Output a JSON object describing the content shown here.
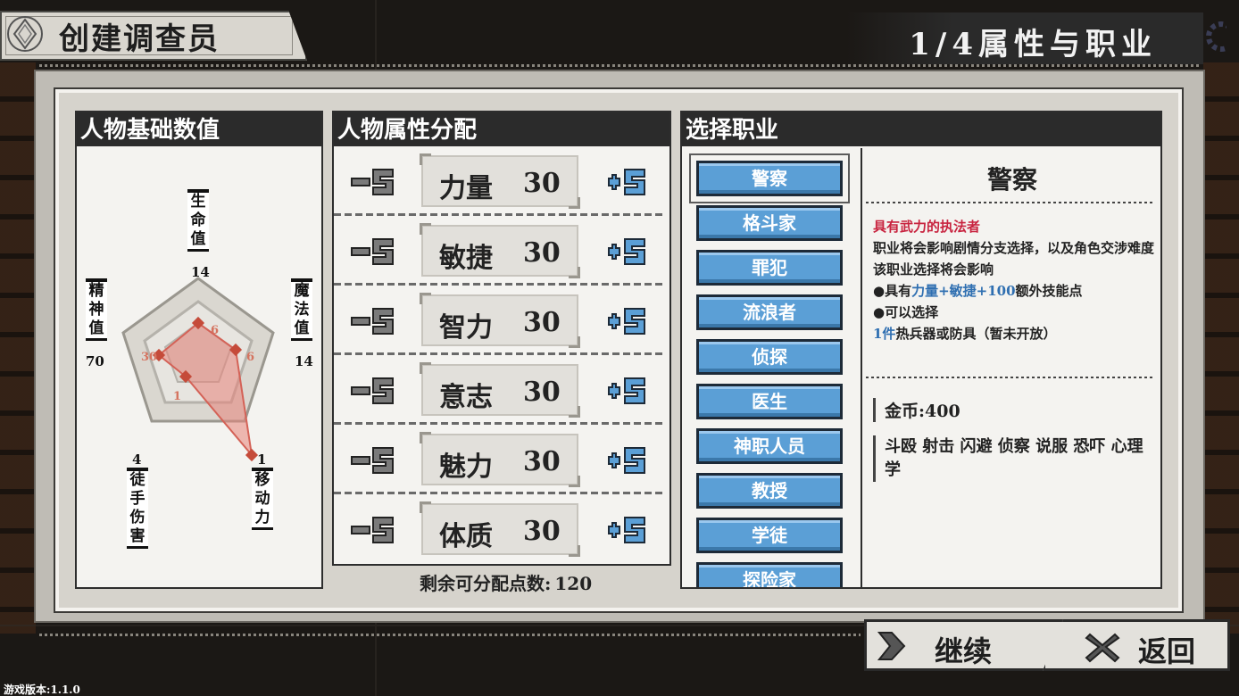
{
  "header": {
    "title": "创建调查员",
    "step": "1/4属性与职业"
  },
  "stats_panel": {
    "title": "人物基础数值",
    "vertices": [
      {
        "label": "生\n命\n值",
        "value": "14"
      },
      {
        "label": "魔\n法\n值",
        "value": "14"
      },
      {
        "label": "移\n动\n力",
        "value": "1"
      },
      {
        "label": "徒\n手\n伤\n害",
        "value": "4"
      },
      {
        "label": "精\n神\n值",
        "value": "70"
      }
    ],
    "inner_labels": {
      "top": "6",
      "right": "6",
      "left": "30",
      "lower_left": "1"
    }
  },
  "attributes_panel": {
    "title": "人物属性分配",
    "attributes": [
      {
        "name": "力量",
        "value": "30"
      },
      {
        "name": "敏捷",
        "value": "30"
      },
      {
        "name": "智力",
        "value": "30"
      },
      {
        "name": "意志",
        "value": "30"
      },
      {
        "name": "魅力",
        "value": "30"
      },
      {
        "name": "体质",
        "value": "30"
      }
    ],
    "remaining_label": "剩余可分配点数:",
    "remaining_value": "120"
  },
  "jobs_panel": {
    "title": "选择职业",
    "jobs": [
      "警察",
      "格斗家",
      "罪犯",
      "流浪者",
      "侦探",
      "医生",
      "神职人员",
      "教授",
      "学徒",
      "探险家"
    ],
    "selected": "警察",
    "detail": {
      "name": "警察",
      "tagline": "具有武力的执法者",
      "line1": "职业将会影响剧情分支选择，以及角色交涉难度",
      "line2": "该职业选择将会影响",
      "bullet1_prefix": "●具有",
      "bullet1_highlight": "力量+敏捷+100",
      "bullet1_suffix": "额外技能点",
      "bullet2": "●可以选择",
      "bullet3_highlight": "1件",
      "bullet3_suffix": "热兵器或防具（暂未开放）",
      "gold": "金币:400",
      "skills": "斗殴 射击 闪避 侦察 说服 恐吓 心理学"
    }
  },
  "buttons": {
    "continue": "继续",
    "back": "返回"
  },
  "version": "游戏版本:1.1.0",
  "colors": {
    "job_button": "#5b9fd6",
    "tagline": "#c8233f",
    "highlight": "#2f6fb1",
    "radar_fill": "#e8837a"
  }
}
